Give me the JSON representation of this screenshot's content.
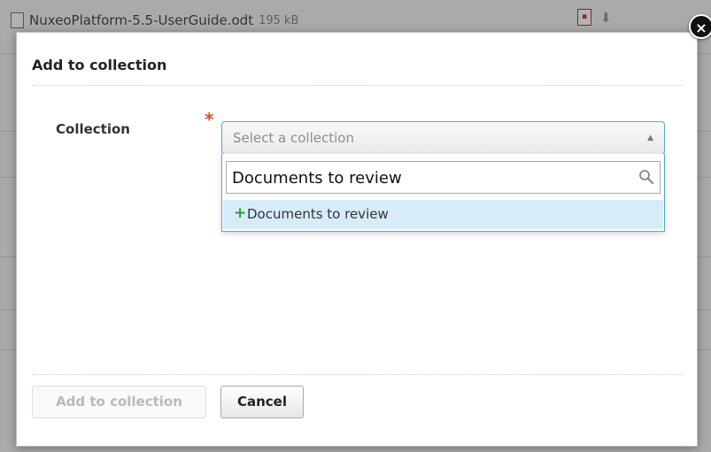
{
  "background": {
    "file_name": "NuxeoPlatform-5.5-UserGuide.odt",
    "file_size": "195 kB"
  },
  "dialog": {
    "title": "Add to collection",
    "field_label": "Collection",
    "required_marker": "*",
    "select_placeholder": "Select a collection",
    "search_value": "Documents to review",
    "option_label": "Documents to review",
    "option_prefix": "+",
    "add_button": "Add to collection",
    "cancel_button": "Cancel",
    "close_glyph": "×"
  },
  "icons": {
    "close": "close-icon",
    "search": "search-icon",
    "plus": "plus-icon",
    "select_arrow": "triangle-up-icon"
  },
  "colors": {
    "required": "#d5531c",
    "focus_border": "#5aa3d5",
    "option_highlight": "#d6ecf9",
    "plus_green": "#2a9c34"
  }
}
